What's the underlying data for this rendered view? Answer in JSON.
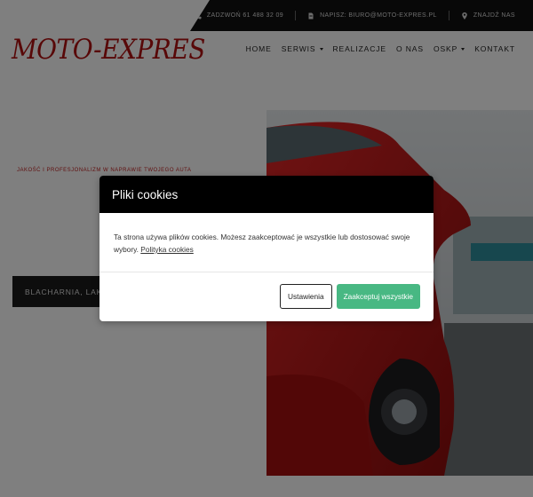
{
  "topbar": {
    "phone": "ZADZWOŃ 61 488 32 09",
    "email": "NAPISZ: BIURO@MOTO-EXPRES.PL",
    "location": "ZNAJDŹ NAS",
    "icons": [
      "phone-icon",
      "document-icon",
      "map-pin-icon"
    ]
  },
  "header": {
    "logo": "MOTO-EXPRES",
    "nav": [
      {
        "label": "HOME",
        "has_dropdown": false
      },
      {
        "label": "SERWIS",
        "has_dropdown": true
      },
      {
        "label": "REALIZACJE",
        "has_dropdown": false
      },
      {
        "label": "O NAS",
        "has_dropdown": false
      },
      {
        "label": "OSKP",
        "has_dropdown": true
      },
      {
        "label": "KONTAKT",
        "has_dropdown": false
      }
    ]
  },
  "hero": {
    "tagline": "JAKOŚĆ I PROFESJONALIZM W NAPRAWIE TWOJEGO AUTA",
    "button": "BLACHARNIA, LAKIER"
  },
  "cookie_modal": {
    "title": "Pliki cookies",
    "body": "Ta strona używa plików cookies. Możesz zaakceptować je wszystkie lub dostosować swoje wybory.",
    "link": "Polityka cookies",
    "settings_button": "Ustawienia",
    "accept_button": "Zaakceptuj wszystkie"
  },
  "colors": {
    "logo": "#b01010",
    "accept": "#48b883",
    "topbar": "#111111"
  }
}
